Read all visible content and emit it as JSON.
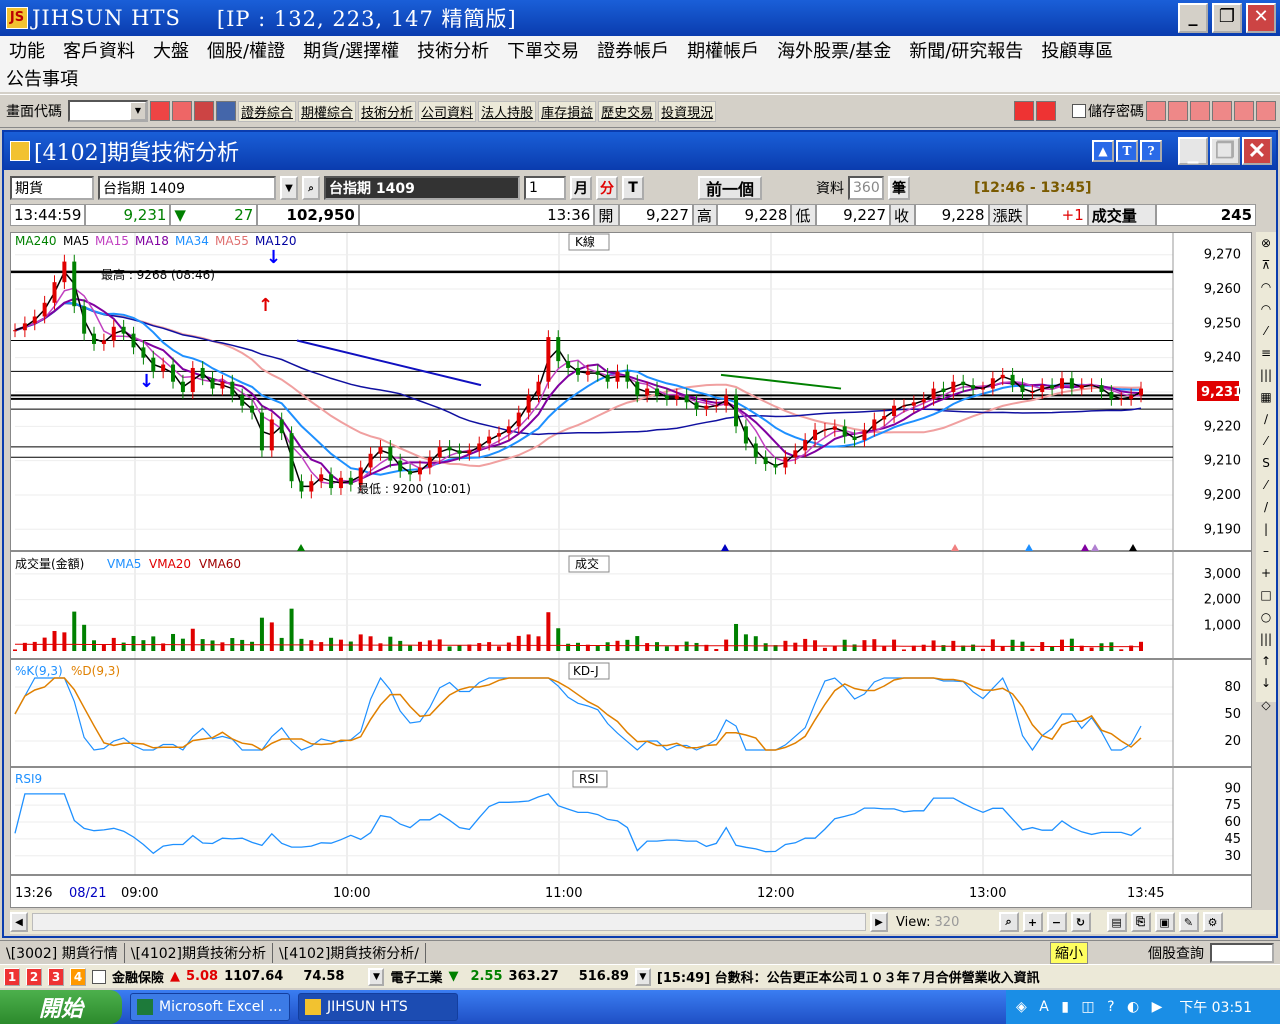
{
  "app": {
    "title": "JIHSUN HTS",
    "ip_info": "[IP : 132, 223, 147 精簡版]",
    "logo": "JS"
  },
  "window_buttons": {
    "min": "_",
    "max": "❐",
    "close": "✕"
  },
  "menu": {
    "row1": [
      "功能",
      "客戶資料",
      "大盤",
      "個股/權證",
      "期貨/選擇權",
      "技術分析",
      "下單交易",
      "證券帳戶",
      "期權帳戶",
      "海外股票/基金",
      "新聞/研究報告",
      "投顧專區"
    ],
    "row2": [
      "公告事項"
    ]
  },
  "toolbar": {
    "code_label": "畫面代碼",
    "links": [
      "證券綜合",
      "期權綜合",
      "技術分析",
      "公司資料",
      "法人持股",
      "庫存損益",
      "歷史交易",
      "投資現況"
    ],
    "save_pwd": "儲存密碼"
  },
  "child": {
    "title": "[4102]期貨技術分析",
    "help": [
      "▲",
      "T",
      "?"
    ]
  },
  "controls": {
    "market": "期貨",
    "symbol": "台指期 1409",
    "symbol_display": "台指期 1409",
    "period": "1",
    "btn_month": "月",
    "btn_min": "分",
    "btn_t": "T",
    "prev": "前一個",
    "data_label": "資料",
    "data_count": "360",
    "data_unit": "筆",
    "time_range": "[12:46 - 13:45]"
  },
  "quote": {
    "time": "13:44:59",
    "price": "9,231",
    "change": "27",
    "volume_total": "102,950",
    "bar_time": "13:36",
    "open_label": "開",
    "open": "9,227",
    "high_label": "高",
    "high": "9,228",
    "low_label": "低",
    "low": "9,227",
    "close_label": "收",
    "close": "9,228",
    "chg_label": "漲跌",
    "chg": "+1",
    "vol_label": "成交量",
    "vol": "245"
  },
  "colors": {
    "red": "#e00000",
    "green": "#008000",
    "blue": "#0000ff",
    "accent": "#0a3cae"
  },
  "chart_data": {
    "type": "line",
    "panels": [
      {
        "name": "K線",
        "legend": [
          "MA240",
          "MA5",
          "MA15",
          "MA18",
          "MA34",
          "MA55",
          "MA120"
        ],
        "yticks": [
          9270,
          9260,
          9250,
          9240,
          9230,
          9220,
          9210,
          9200,
          9190
        ],
        "ylim": [
          9186,
          9274
        ],
        "current": "9,231",
        "annotations": {
          "high": "最高 : 9268 (08:46)",
          "low": "最低 : 9200 (10:01)"
        },
        "close": [
          9248,
          9250,
          9252,
          9256,
          9262,
          9268,
          9255,
          9247,
          9244,
          9245,
          9249,
          9247,
          9243,
          9240,
          9236,
          9238,
          9233,
          9230,
          9237,
          9234,
          9231,
          9233,
          9229,
          9226,
          9224,
          9213,
          9222,
          9218,
          9204,
          9201,
          9204,
          9206,
          9202,
          9205,
          9203,
          9208,
          9212,
          9214,
          9210,
          9207,
          9206,
          9208,
          9211,
          9214,
          9213,
          9212,
          9213,
          9215,
          9217,
          9218,
          9220,
          9224,
          9229,
          9233,
          9246,
          9239,
          9237,
          9235,
          9236,
          9235,
          9233,
          9236,
          9233,
          9229,
          9231,
          9229,
          9228,
          9229,
          9227,
          9225,
          9226,
          9226,
          9229,
          9220,
          9215,
          9211,
          9209,
          9208,
          9211,
          9213,
          9216,
          9219,
          9219,
          9220,
          9217,
          9216,
          9219,
          9222,
          9223,
          9226,
          9226,
          9227,
          9228,
          9231,
          9230,
          9233,
          9232,
          9231,
          9231,
          9234,
          9235,
          9232,
          9230,
          9230,
          9232,
          9231,
          9234,
          9231,
          9232,
          9232,
          9230,
          9228,
          9228,
          9229,
          9231
        ]
      },
      {
        "name": "成交",
        "legend": [
          "成交量(金額)",
          "VMA5",
          "VMA20",
          "VMA60"
        ],
        "yticks": [
          3000,
          2000,
          1000
        ],
        "ylim": [
          0,
          3500
        ]
      },
      {
        "name": "KD-J",
        "legend": [
          "%K(9,3)",
          "%D(9,3)"
        ],
        "yticks": [
          80,
          50,
          20
        ],
        "ylim": [
          0,
          100
        ]
      },
      {
        "name": "RSI",
        "legend": [
          "RSI9"
        ],
        "yticks": [
          90,
          75,
          60,
          45,
          30
        ],
        "ylim": [
          20,
          100
        ]
      }
    ],
    "xticks": [
      "13:26",
      "08/21",
      "09:00",
      "10:00",
      "11:00",
      "12:00",
      "13:00",
      "13:45"
    ]
  },
  "rtools": [
    "⊗",
    "⊼",
    "◠",
    "◠",
    "⁄",
    "≡",
    "|||",
    "▦",
    "∕",
    "⁄",
    "S",
    "⁄",
    "/",
    "|",
    "–",
    "+",
    "□",
    "○",
    "|||",
    "↑",
    "↓",
    "◇"
  ],
  "scroll": {
    "view_label": "View:",
    "view_value": "320"
  },
  "tabs": [
    "\\[3002] 期貨行情",
    "\\[4102]期貨技術分析",
    "\\[4102]期貨技術分析/"
  ],
  "tabs_right": {
    "shrink": "縮小",
    "stock_query": "個股查詢"
  },
  "ticker": {
    "nums": [
      "1",
      "2",
      "3",
      "4"
    ],
    "item1_name": "金融保險",
    "item1_chg": "5.08",
    "item1_val": "1107.64",
    "item1_vol": "74.58",
    "item2_name": "電子工業",
    "item2_chg": "2.55",
    "item2_val": "363.27",
    "item2_vol": "516.89",
    "news": "[15:49] 台數科：公告更正本公司１０３年７月合併營業收入資訊"
  },
  "taskbar": {
    "start": "開始",
    "tasks": [
      "Microsoft Excel ...",
      "JIHSUN HTS"
    ],
    "clock": "下午 03:51"
  }
}
